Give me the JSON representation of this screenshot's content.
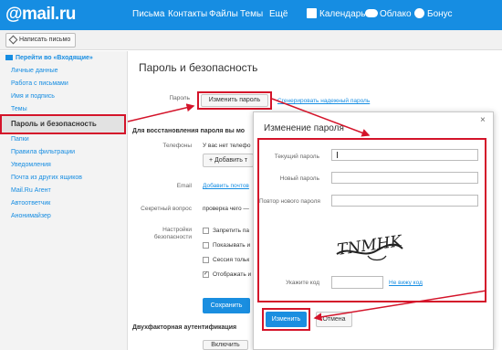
{
  "header": {
    "logo": "@mail.ru",
    "nav": [
      "Письма",
      "Контакты",
      "Файлы",
      "Темы",
      "Ещё"
    ],
    "right": [
      "Календарь",
      "Облако",
      "Бонус"
    ]
  },
  "toolbar": {
    "compose_label": "Написать письмо"
  },
  "sidebar": {
    "back_label": "Перейти во «Входящие»",
    "items": [
      "Личные данные",
      "Работа с письмами",
      "Имя и подпись",
      "Темы",
      "Пароль и безопасность",
      "Папки",
      "Правила фильтрации",
      "Уведомления",
      "Почта из других ящиков",
      "Mail.Ru Агент",
      "Автоответчик",
      "Анонимайзер"
    ]
  },
  "main": {
    "title": "Пароль и безопасность",
    "password_label": "Пароль",
    "change_password_button": "Изменить пароль",
    "generate_link": "Сгенерировать надежный пароль",
    "recovery_heading": "Для восстановления пароля вы мо",
    "phones_label": "Телефоны",
    "phones_text": "У вас нет телефо",
    "add_phone_button": "+ Добавить т",
    "email_label": "Email",
    "email_link": "Добавить почтов",
    "secret_label": "Секретный вопрос",
    "secret_value": "проверка чего —",
    "security_settings_label": "Настройки безопасности",
    "checkboxes": [
      "Запретить па",
      "Показывать и",
      "Сессия тольк",
      "Отображать и"
    ],
    "save_button": "Сохранить",
    "twofactor_heading": "Двухфакторная аутентификация",
    "enable_button": "Включить"
  },
  "modal": {
    "title": "Изменение пароля",
    "close": "×",
    "current_password_label": "Текущий пароль",
    "new_password_label": "Новый пароль",
    "repeat_password_label": "Повтор нового пароля",
    "code_label": "Укажите код",
    "cant_see_link": "Не вижу код",
    "submit_button": "Изменить",
    "cancel_button": "Отмена",
    "captcha_text": "TNMHK"
  },
  "colors": {
    "brand": "#168de2",
    "highlight": "#d4142a"
  }
}
